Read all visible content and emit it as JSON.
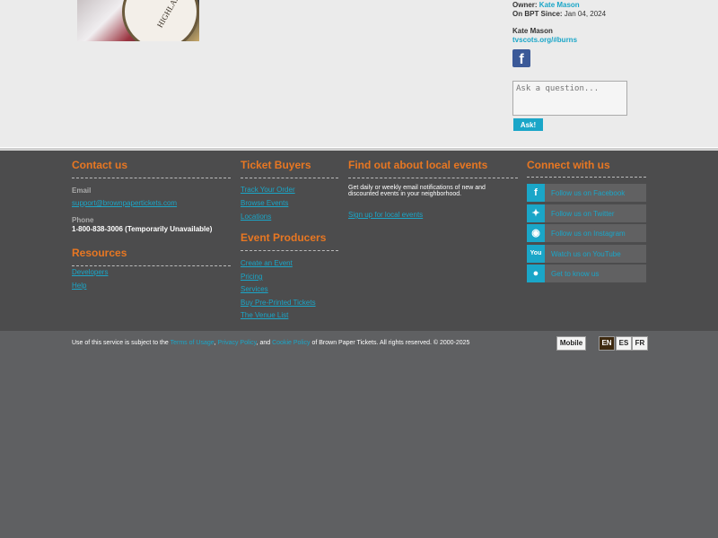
{
  "owner": {
    "owner_label": "Owner:",
    "owner_name": "Kate Mason",
    "since_label": "On BPT Since:",
    "since_date": "Jan 04, 2024",
    "contact_name": "Kate Mason",
    "contact_link": "tvscots.org/#burns"
  },
  "photo": {
    "seal_text": "HIGHLANDE"
  },
  "ask": {
    "placeholder": "Ask a question...",
    "button": "Ask!"
  },
  "footer": {
    "contact": {
      "heading": "Contact us",
      "email_label": "Email",
      "email": "support@brownpapertickets.com",
      "phone_label": "Phone",
      "phone": "1-800-838-3006 (Temporarily Unavailable)"
    },
    "resources": {
      "heading": "Resources",
      "links": [
        "Developers",
        "Help"
      ]
    },
    "ticket_buyers": {
      "heading": "Ticket Buyers",
      "links": [
        "Track Your Order",
        "Browse Events",
        "Locations"
      ]
    },
    "event_producers": {
      "heading": "Event Producers",
      "links": [
        "Create an Event",
        "Pricing",
        "Services",
        "Buy Pre-Printed Tickets",
        "The Venue List"
      ]
    },
    "local": {
      "heading": "Find out about local events",
      "desc_line1": "Get daily or weekly email notifications of new and",
      "desc_line2": "discounted events in your neighborhood.",
      "link": "Sign up for local events"
    },
    "connect": {
      "heading": "Connect with us",
      "items": [
        {
          "label": "Follow us on Facebook",
          "icon": "facebook-icon"
        },
        {
          "label": "Follow us on Twitter",
          "icon": "twitter-icon"
        },
        {
          "label": "Follow us on Instagram",
          "icon": "instagram-icon"
        },
        {
          "label": "Watch us on YouTube",
          "icon": "youtube-icon"
        },
        {
          "label": "Get to know us",
          "icon": "bpt-icon"
        }
      ]
    }
  },
  "legal": {
    "prefix": "Use of this service is subject to the",
    "terms": "Terms of Usage",
    "privacy": "Privacy Policy",
    "and": ", and",
    "cookie": "Cookie Policy",
    "suffix": "of Brown Paper Tickets. All rights reserved. © 2000-2025"
  },
  "controls": {
    "mobile": "Mobile",
    "langs": [
      "EN",
      "ES",
      "FR"
    ]
  },
  "colors": {
    "accent": "#1aa6c8",
    "heading": "#e87722",
    "footer_bg": "#4c4c4d",
    "page_bg": "#ebebeb"
  }
}
